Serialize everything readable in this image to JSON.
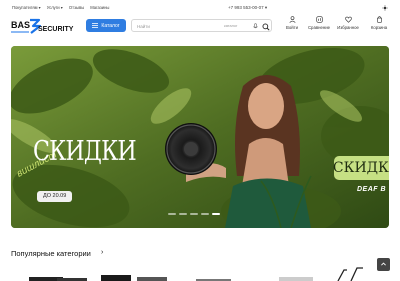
{
  "topbar": {
    "nav": [
      "Покупателям ▾",
      "Услуги ▾",
      "Отзывы",
      "Магазины"
    ],
    "phone": "+7 993 553-00-07 ▾"
  },
  "brand": {
    "logo_text": "BASSECURITY",
    "logo_part1": "BAS",
    "logo_part2": "SECURITY"
  },
  "catalog_button": {
    "label": "Каталог"
  },
  "search": {
    "placeholder": "Найти",
    "category": "каталог"
  },
  "header_icons": [
    {
      "icon": "login-icon",
      "label": "Войти"
    },
    {
      "icon": "compare-icon",
      "label": "Сравнение"
    },
    {
      "icon": "heart-icon",
      "label": "Избранное"
    },
    {
      "icon": "cart-icon",
      "label": "Корзина"
    }
  ],
  "banner": {
    "title": "СКИДКИ",
    "script_text": "вишлист",
    "date_label": "ДО 20.09",
    "badge": "СКИДКИ",
    "brand": "DEAF B",
    "prev": "‹",
    "next": "›",
    "slides_total": 5,
    "active_slide": 4
  },
  "categories": {
    "title": "Популярные категории",
    "arrow": "›"
  },
  "colors": {
    "accent": "#2f7de1",
    "banner_green": "#5f7d2e",
    "badge": "#c6e084"
  }
}
